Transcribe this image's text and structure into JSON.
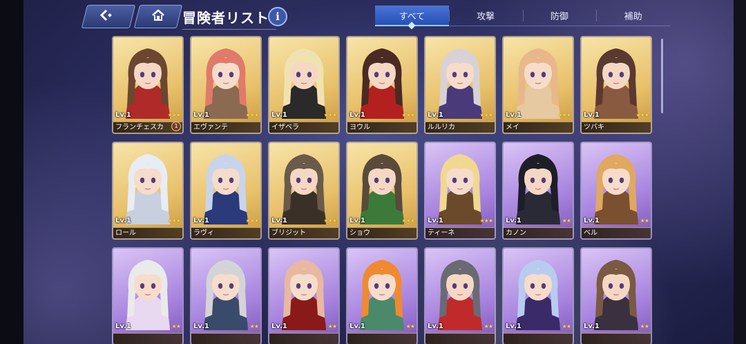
{
  "header": {
    "back_icon": "back-arrow-icon",
    "home_icon": "home-icon",
    "title": "冒険者リスト",
    "info_label": "i"
  },
  "tabs": [
    {
      "label": "すべて",
      "active": true
    },
    {
      "label": "攻撃",
      "active": false
    },
    {
      "label": "防御",
      "active": false
    },
    {
      "label": "補助",
      "active": false
    }
  ],
  "cards": [
    {
      "name": "フランチェスカ",
      "level": "Lv.1",
      "rarity": "gold",
      "stars": 3,
      "badge": "1",
      "hair": "#6b4630",
      "skin": "#f4d8c4",
      "accent": "#b02a2a"
    },
    {
      "name": "エヴァンテ",
      "level": "Lv.1",
      "rarity": "gold",
      "stars": 3,
      "badge": "",
      "hair": "#e07a6a",
      "skin": "#f6dccb",
      "accent": "#8a6a50"
    },
    {
      "name": "イザベラ",
      "level": "Lv.1",
      "rarity": "gold",
      "stars": 3,
      "badge": "",
      "hair": "#f0e2b0",
      "skin": "#f4d8c4",
      "accent": "#2a2a2a"
    },
    {
      "name": "ヨウル",
      "level": "Lv.1",
      "rarity": "gold",
      "stars": 3,
      "badge": "",
      "hair": "#4a2a22",
      "skin": "#f4d8c4",
      "accent": "#b32020"
    },
    {
      "name": "ルルリカ",
      "level": "Lv.1",
      "rarity": "gold",
      "stars": 3,
      "badge": "",
      "hair": "#d8d2d6",
      "skin": "#f6dccb",
      "accent": "#4b3a7a"
    },
    {
      "name": "メイ",
      "level": "Lv.1",
      "rarity": "gold",
      "stars": 3,
      "badge": "",
      "hair": "#e8b88a",
      "skin": "#f6dccb",
      "accent": "#e6c9a0"
    },
    {
      "name": "ツバキ",
      "level": "Lv.1",
      "rarity": "gold",
      "stars": 3,
      "badge": "",
      "hair": "#5a3a30",
      "skin": "#f4d8c4",
      "accent": "#8a5a40"
    },
    {
      "name": "ロール",
      "level": "Lv.1",
      "rarity": "gold",
      "stars": 3,
      "badge": "",
      "hair": "#e8ecf4",
      "skin": "#f6dccb",
      "accent": "#c8d0e0"
    },
    {
      "name": "ラヴィ",
      "level": "Lv.1",
      "rarity": "gold",
      "stars": 3,
      "badge": "",
      "hair": "#c8d4ec",
      "skin": "#f6dccb",
      "accent": "#2a3a7a"
    },
    {
      "name": "ブリジット",
      "level": "Lv.1",
      "rarity": "gold",
      "stars": 3,
      "badge": "",
      "hair": "#6a5a4a",
      "skin": "#f4d8c4",
      "accent": "#3a3028"
    },
    {
      "name": "ショウ",
      "level": "Lv.1",
      "rarity": "gold",
      "stars": 3,
      "badge": "",
      "hair": "#5a4a3a",
      "skin": "#f4d8c4",
      "accent": "#3c7a3a"
    },
    {
      "name": "ティーネ",
      "level": "Lv.1",
      "rarity": "purple",
      "stars": 3,
      "badge": "",
      "hair": "#f0d890",
      "skin": "#f6dccb",
      "accent": "#6a4a2a"
    },
    {
      "name": "カノン",
      "level": "Lv.1",
      "rarity": "purple",
      "stars": 2,
      "badge": "",
      "hair": "#1e1e28",
      "skin": "#f4d8c4",
      "accent": "#2a2a36"
    },
    {
      "name": "ベル",
      "level": "Lv.1",
      "rarity": "purple",
      "stars": 2,
      "badge": "",
      "hair": "#e0a860",
      "skin": "#f6dccb",
      "accent": "#7a5030"
    },
    {
      "name": "",
      "level": "Lv.1",
      "rarity": "purple",
      "stars": 2,
      "badge": "",
      "hair": "#eaeaea",
      "skin": "#f6dccb",
      "accent": "#e8d8f0"
    },
    {
      "name": "",
      "level": "Lv.1",
      "rarity": "purple",
      "stars": 2,
      "badge": "",
      "hair": "#d4d4d8",
      "skin": "#f6dccb",
      "accent": "#3a4a6a"
    },
    {
      "name": "",
      "level": "Lv.1",
      "rarity": "purple",
      "stars": 2,
      "badge": "",
      "hair": "#e8b8a0",
      "skin": "#f6dccb",
      "accent": "#8a1a1a"
    },
    {
      "name": "",
      "level": "Lv.1",
      "rarity": "purple",
      "stars": 2,
      "badge": "",
      "hair": "#f08a30",
      "skin": "#f6dccb",
      "accent": "#4a8a6a"
    },
    {
      "name": "",
      "level": "Lv.1",
      "rarity": "purple",
      "stars": 2,
      "badge": "",
      "hair": "#6a6a72",
      "skin": "#f4d8c4",
      "accent": "#c02a2a"
    },
    {
      "name": "",
      "level": "Lv.1",
      "rarity": "purple",
      "stars": 2,
      "badge": "",
      "hair": "#b8ccf0",
      "skin": "#f6dccb",
      "accent": "#3a2a6a"
    },
    {
      "name": "",
      "level": "Lv.1",
      "rarity": "purple",
      "stars": 2,
      "badge": "",
      "hair": "#7a5a40",
      "skin": "#f4d8c4",
      "accent": "#3a3040"
    }
  ]
}
